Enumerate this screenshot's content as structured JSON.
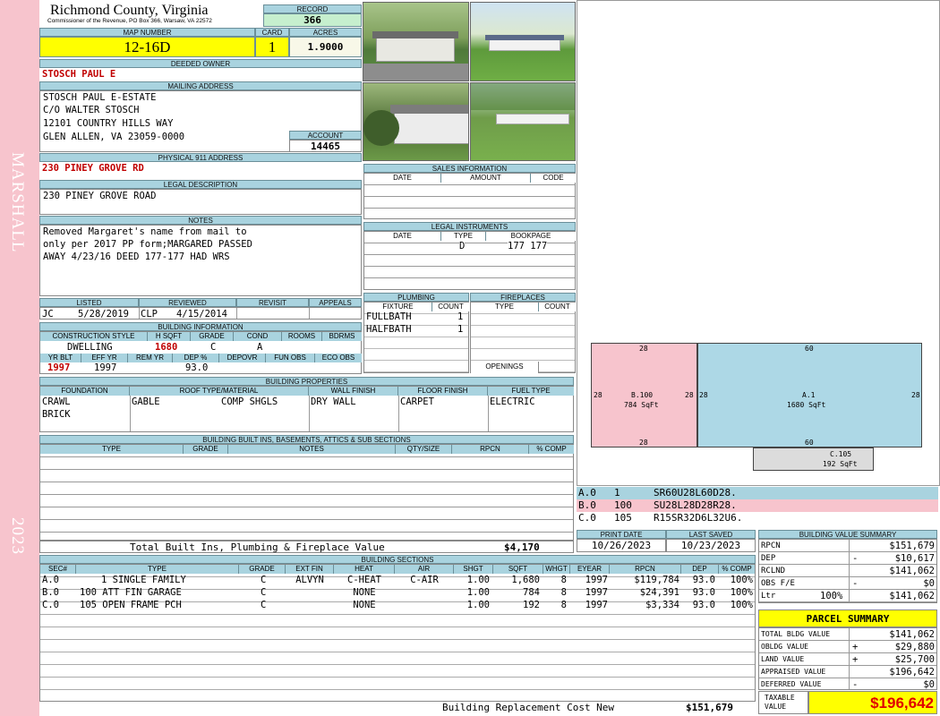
{
  "sidebar": {
    "district": "MARSHALL",
    "year": "2023"
  },
  "header": {
    "county": "Richmond County, Virginia",
    "commissioner": "Commissioner of the Revenue, PO Box 366, Warsaw, VA 22572",
    "record_label": "RECORD",
    "record": "366",
    "map_label": "MAP NUMBER",
    "map": "12-16D",
    "card_label": "CARD",
    "card": "1",
    "acres_label": "ACRES",
    "acres": "1.9000"
  },
  "owner": {
    "label": "DEEDED OWNER",
    "name": "STOSCH PAUL E"
  },
  "mailing": {
    "label": "MAILING ADDRESS",
    "lines": [
      "STOSCH PAUL E-ESTATE",
      "C/O WALTER STOSCH",
      "12101 COUNTRY HILLS WAY",
      "GLEN ALLEN, VA 23059-0000"
    ],
    "account_label": "ACCOUNT",
    "account": "14465"
  },
  "physical": {
    "label": "PHYSICAL 911 ADDRESS",
    "address": "230 PINEY GROVE RD"
  },
  "legal": {
    "label": "LEGAL DESCRIPTION",
    "text": "230 PINEY GROVE ROAD"
  },
  "notes": {
    "label": "NOTES",
    "lines": [
      "Removed Margaret's name from mail to",
      "only per 2017 PP form;MARGARED PASSED",
      "AWAY 4/23/16 DEED 177-177 HAD WRS"
    ]
  },
  "status": {
    "headers": [
      "LISTED",
      "REVIEWED",
      "REVISIT",
      "APPEALS"
    ],
    "listed_by": "JC",
    "listed_date": "5/28/2019",
    "reviewed_by": "CLP",
    "reviewed_date": "4/15/2014"
  },
  "building_info": {
    "label": "BUILDING INFORMATION",
    "headers1": [
      "CONSTRUCTION STYLE",
      "H SQFT",
      "GRADE",
      "COND",
      "ROOMS",
      "BDRMS"
    ],
    "style": "DWELLING",
    "hsqft": "1680",
    "grade": "C",
    "cond": "A",
    "headers2": [
      "YR BLT",
      "EFF YR",
      "REM YR",
      "DEP %",
      "DEPOVR",
      "FUN OBS",
      "ECO OBS"
    ],
    "yr_blt": "1997",
    "eff_yr": "1997",
    "dep": "93.0"
  },
  "properties": {
    "label": "BUILDING PROPERTIES",
    "headers": [
      "FOUNDATION",
      "ROOF TYPE/MATERIAL",
      "WALL FINISH",
      "FLOOR FINISH",
      "FUEL TYPE"
    ],
    "foundation": [
      "CRAWL",
      "BRICK"
    ],
    "roof_type": "GABLE",
    "roof_material": "COMP SHGLS",
    "wall": "DRY WALL",
    "floor": "CARPET",
    "fuel": "ELECTRIC"
  },
  "builtins": {
    "label": "BUILDING BUILT INS, BASEMENTS, ATTICS & SUB SECTIONS",
    "headers": [
      "TYPE",
      "GRADE",
      "NOTES",
      "QTY/SIZE",
      "RPCN",
      "% COMP"
    ],
    "total_label": "Total Built Ins, Plumbing & Fireplace Value",
    "total": "$4,170"
  },
  "sales": {
    "label": "SALES INFORMATION",
    "headers": [
      "DATE",
      "AMOUNT",
      "CODE"
    ]
  },
  "instruments": {
    "label": "LEGAL INSTRUMENTS",
    "headers": [
      "DATE",
      "TYPE",
      "BOOKPAGE"
    ],
    "type": "D",
    "bookpage": "177 177"
  },
  "plumbing": {
    "label": "PLUMBING",
    "headers": [
      "FIXTURE",
      "COUNT"
    ],
    "rows": [
      {
        "fixture": "FULLBATH",
        "count": "1"
      },
      {
        "fixture": "HALFBATH",
        "count": "1"
      }
    ]
  },
  "fireplaces": {
    "label": "FIREPLACES",
    "headers": [
      "TYPE",
      "COUNT"
    ],
    "openings_label": "OPENINGS"
  },
  "sketch": {
    "b_top": "28",
    "b_left": "28",
    "b_right": "28",
    "b_bottom": "28",
    "b_name": "B.100",
    "b_area": "784 SqFt",
    "a_top": "60",
    "a_left": "28",
    "a_right": "28",
    "a_bottom": "60",
    "a_name": "A.1",
    "a_area": "1680 SqFt",
    "c_name": "C.105",
    "c_area": "192 SqFt"
  },
  "vectors": [
    {
      "sec": "A.0",
      "code": "1",
      "path": "SR60U28L60D28.",
      "color": "#a9d3df"
    },
    {
      "sec": "B.0",
      "code": "100",
      "path": "SU28L28D28R28.",
      "color": "#f7c4cd"
    },
    {
      "sec": "C.0",
      "code": "105",
      "path": "R15SR32D6L32U6.",
      "color": "#dcdcdc"
    }
  ],
  "dates": {
    "print_label": "PRINT DATE",
    "print": "10/26/2023",
    "saved_label": "LAST SAVED",
    "saved": "10/23/2023"
  },
  "sections": {
    "label": "BUILDING SECTIONS",
    "headers": [
      "SEC#",
      "TYPE",
      "GRADE",
      "EXT FIN",
      "HEAT",
      "AIR",
      "SHGT",
      "SQFT",
      "WHGT",
      "EYEAR",
      "RPCN",
      "DEP",
      "% COMP"
    ],
    "rows": [
      [
        "A.0",
        "1 SINGLE FAMILY",
        "C",
        "ALVYN",
        "C-HEAT",
        "C-AIR",
        "1.00",
        "1,680",
        "8",
        "1997",
        "$119,784",
        "93.0",
        "100%"
      ],
      [
        "B.0",
        "100 ATT FIN GARAGE",
        "C",
        "",
        "NONE",
        "",
        "1.00",
        "784",
        "8",
        "1997",
        "$24,391",
        "93.0",
        "100%"
      ],
      [
        "C.0",
        "105 OPEN FRAME PCH",
        "C",
        "",
        "NONE",
        "",
        "1.00",
        "192",
        "8",
        "1997",
        "$3,334",
        "93.0",
        "100%"
      ]
    ],
    "total_label": "Building Replacement Cost New",
    "total": "$151,679"
  },
  "value_summary": {
    "label": "BUILDING VALUE SUMMARY",
    "rpcn_l": "RPCN",
    "rpcn": "$151,679",
    "dep_l": "DEP",
    "dep_sign": "-",
    "dep": "$10,617",
    "rclnd_l": "RCLND",
    "rclnd": "$141,062",
    "obs_l": "OBS F/E",
    "obs_sign": "-",
    "obs": "$0",
    "ltr_l": "Ltr",
    "ltr_pct": "100%",
    "ltr": "$141,062"
  },
  "parcel": {
    "label": "PARCEL SUMMARY",
    "bldg_l": "TOTAL BLDG VALUE",
    "bldg": "$141,062",
    "obldg_l": "OBLDG VALUE",
    "obldg_sign": "+",
    "obldg": "$29,880",
    "land_l": "LAND VALUE",
    "land_sign": "+",
    "land": "$25,700",
    "appr_l": "APPRAISED VALUE",
    "appr": "$196,642",
    "def_l": "DEFERRED VALUE",
    "def_sign": "-",
    "def": "$0",
    "taxable_l1": "TAXABLE",
    "taxable_l2": "VALUE",
    "taxable": "$196,642"
  }
}
